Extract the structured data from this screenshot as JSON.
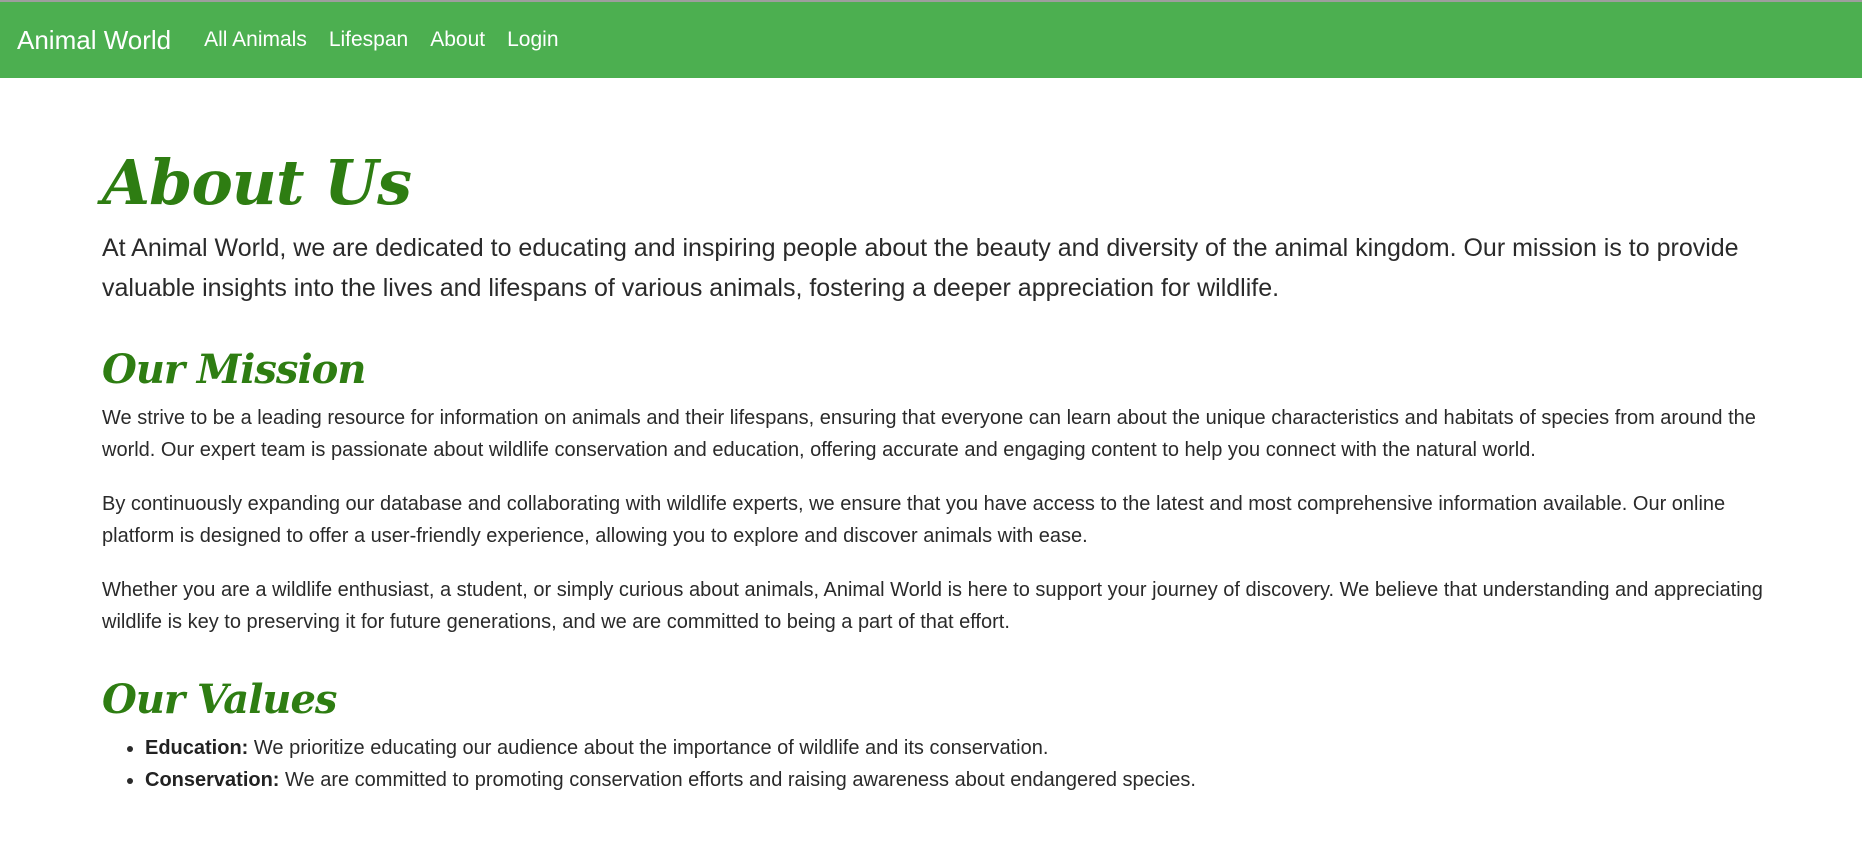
{
  "navbar": {
    "brand": "Animal World",
    "links": [
      {
        "label": "All Animals"
      },
      {
        "label": "Lifespan"
      },
      {
        "label": "About"
      },
      {
        "label": "Login"
      }
    ],
    "background": "#4caf50"
  },
  "page": {
    "title": "About Us",
    "intro": "At Animal World, we are dedicated to educating and inspiring people about the beauty and diversity of the animal kingdom. Our mission is to provide valuable insights into the lives and lifespans of various animals, fostering a deeper appreciation for wildlife.",
    "heading_color": "#2e7d12"
  },
  "mission": {
    "title": "Our Mission",
    "paragraphs": [
      "We strive to be a leading resource for information on animals and their lifespans, ensuring that everyone can learn about the unique characteristics and habitats of species from around the world. Our expert team is passionate about wildlife conservation and education, offering accurate and engaging content to help you connect with the natural world.",
      "By continuously expanding our database and collaborating with wildlife experts, we ensure that you have access to the latest and most comprehensive information available. Our online platform is designed to offer a user-friendly experience, allowing you to explore and discover animals with ease.",
      "Whether you are a wildlife enthusiast, a student, or simply curious about animals, Animal World is here to support your journey of discovery. We believe that understanding and appreciating wildlife is key to preserving it for future generations, and we are committed to being a part of that effort."
    ]
  },
  "values": {
    "title": "Our Values",
    "items": [
      {
        "label": "Education:",
        "text": " We prioritize educating our audience about the importance of wildlife and its conservation."
      },
      {
        "label": "Conservation:",
        "text": " We are committed to promoting conservation efforts and raising awareness about endangered species."
      }
    ]
  }
}
